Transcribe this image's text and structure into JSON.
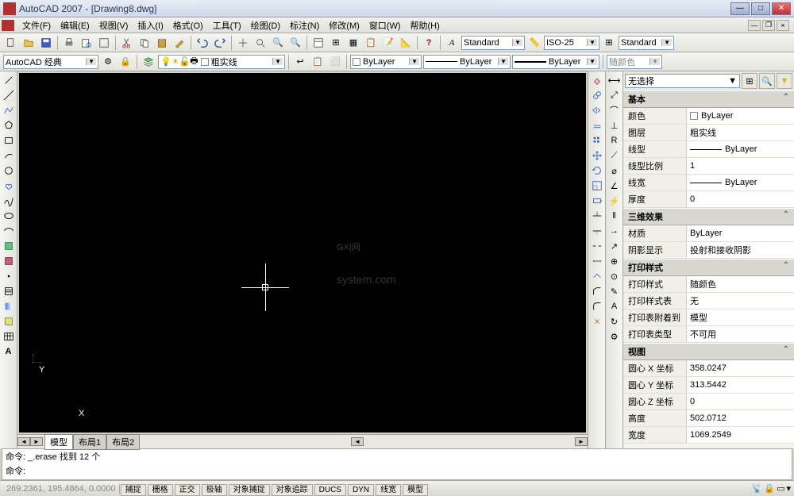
{
  "title": "AutoCAD 2007 - [Drawing8.dwg]",
  "menu": [
    "文件(F)",
    "编辑(E)",
    "视图(V)",
    "插入(I)",
    "格式(O)",
    "工具(T)",
    "绘图(D)",
    "标注(N)",
    "修改(M)",
    "窗口(W)",
    "帮助(H)"
  ],
  "workspace": "AutoCAD 经典",
  "layer_name": "粗实线",
  "style1": "Standard",
  "dimstyle": "ISO-25",
  "style2": "Standard",
  "color_combo": "ByLayer",
  "linetype_combo": "ByLayer",
  "lineweight_combo": "ByLayer",
  "plotstyle_combo": "随颜色",
  "tabs": {
    "model": "模型",
    "layout1": "布局1",
    "layout2": "布局2"
  },
  "cmd": {
    "line1": "命令: _.erase 找到 12 个",
    "line2": "命令:"
  },
  "status": {
    "coords": "269.2361, 195.4864, 0.0000",
    "buttons": [
      "捕捉",
      "栅格",
      "正交",
      "极轴",
      "对象捕捉",
      "对象追踪",
      "DUCS",
      "DYN",
      "线宽",
      "模型"
    ]
  },
  "props": {
    "selection": "无选择",
    "categories": [
      {
        "name": "基本",
        "rows": [
          {
            "k": "颜色",
            "v": "ByLayer",
            "swatch": true
          },
          {
            "k": "图层",
            "v": "粗实线"
          },
          {
            "k": "线型",
            "v": "ByLayer",
            "line": true
          },
          {
            "k": "线型比例",
            "v": "1"
          },
          {
            "k": "线宽",
            "v": "ByLayer",
            "line": true
          },
          {
            "k": "厚度",
            "v": "0"
          }
        ]
      },
      {
        "name": "三维效果",
        "rows": [
          {
            "k": "材质",
            "v": "ByLayer"
          },
          {
            "k": "阴影显示",
            "v": "投射和接收阴影"
          }
        ]
      },
      {
        "name": "打印样式",
        "rows": [
          {
            "k": "打印样式",
            "v": "随颜色"
          },
          {
            "k": "打印样式表",
            "v": "无"
          },
          {
            "k": "打印表附着到",
            "v": "模型"
          },
          {
            "k": "打印表类型",
            "v": "不可用"
          }
        ]
      },
      {
        "name": "视图",
        "rows": [
          {
            "k": "圆心 X 坐标",
            "v": "358.0247"
          },
          {
            "k": "圆心 Y 坐标",
            "v": "313.5442"
          },
          {
            "k": "圆心 Z 坐标",
            "v": "0"
          },
          {
            "k": "高度",
            "v": "502.0712"
          },
          {
            "k": "宽度",
            "v": "1069.2549"
          }
        ]
      }
    ]
  },
  "watermark": {
    "main": "GX|网",
    "sub": "system.com"
  }
}
